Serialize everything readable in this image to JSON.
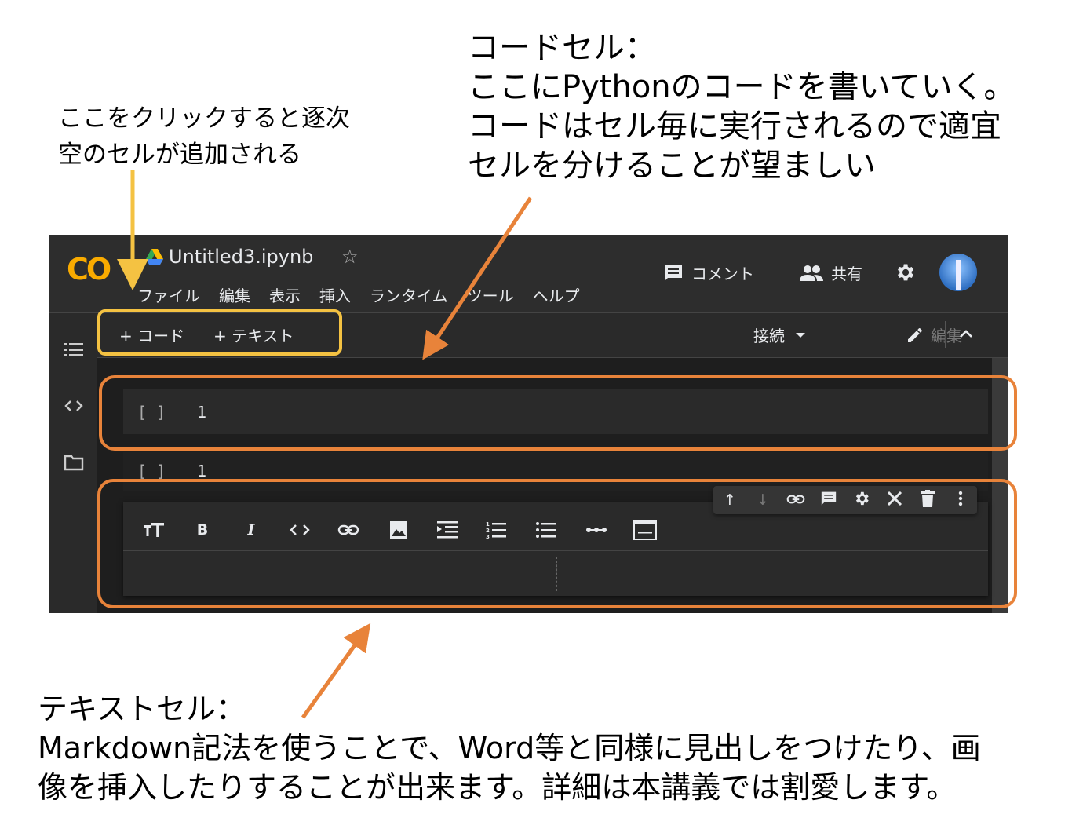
{
  "annotations": {
    "add_cell": "ここをクリックすると逐次\n空のセルが追加される",
    "code_cell": "コードセル：\nここにPythonのコードを書いていく。\nコードはセル毎に実行されるので適宜\nセルを分けることが望ましい",
    "text_cell": "テキストセル：\nMarkdown記法を使うことで、Word等と同様に見出しをつけたり、画\n像を挿入したりすることが出来ます。詳細は本講義では割愛します。"
  },
  "colors": {
    "highlight_yellow": "#f4c242",
    "highlight_orange": "#e8833a",
    "logo_orange": "#f9ab00"
  },
  "header": {
    "logo": "CO",
    "file_title": "Untitled3.ipynb",
    "star_icon": "☆",
    "menu": [
      "ファイル",
      "編集",
      "表示",
      "挿入",
      "ランタイム",
      "ツール",
      "ヘルプ"
    ],
    "comment_label": "コメント",
    "share_label": "共有"
  },
  "toolbar": {
    "add_code": "+ コード",
    "add_text": "+ テキスト",
    "connect": "接続",
    "edit": "編集"
  },
  "cells": [
    {
      "bracket": "[ ]",
      "line_no": "1"
    },
    {
      "bracket": "[ ]",
      "line_no": "1"
    }
  ],
  "text_cell_toolbar": [
    "title-size-icon",
    "bold-icon",
    "italic-icon",
    "code-icon",
    "link-icon",
    "image-icon",
    "indent-icon",
    "numbered-list-icon",
    "bullet-list-icon",
    "horizontal-rule-icon",
    "preview-icon"
  ],
  "cell_actions": [
    "move-up-icon",
    "move-down-icon",
    "link-icon",
    "comment-icon",
    "settings-icon",
    "editor-icon",
    "delete-icon",
    "more-icon"
  ]
}
